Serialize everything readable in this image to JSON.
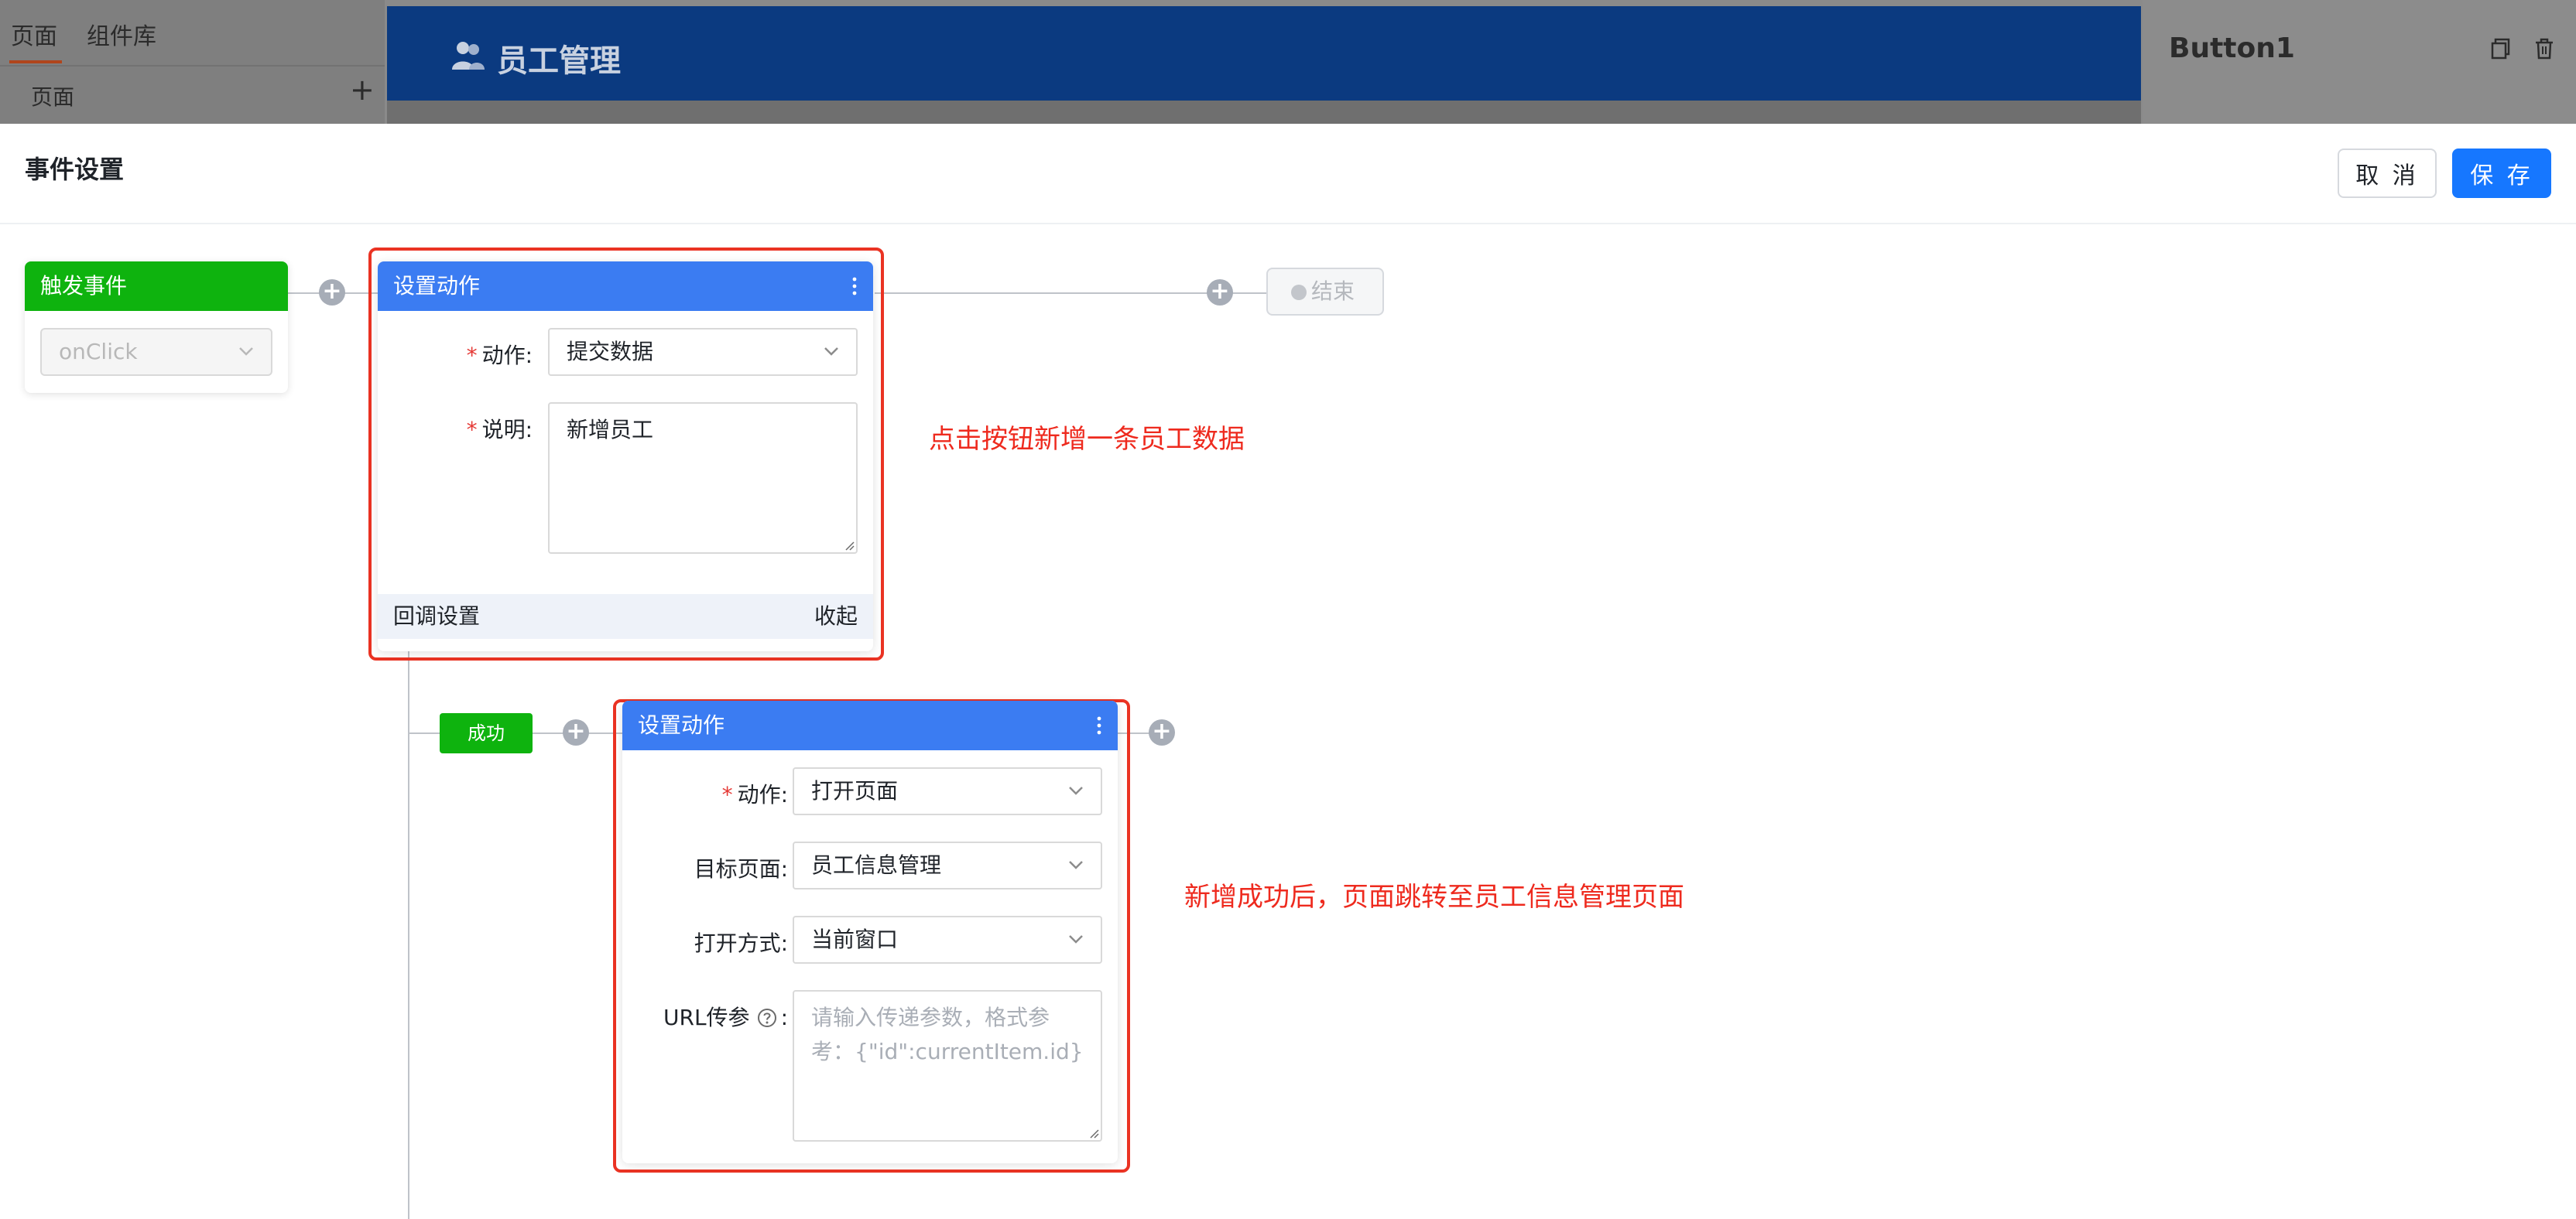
{
  "background": {
    "left_tabs": [
      "页面",
      "组件库"
    ],
    "left_section_label": "页面",
    "add_symbol": "+",
    "app_title": "员工管理",
    "right_component_name": "Button1"
  },
  "modal": {
    "title": "事件设置",
    "cancel_label": "取 消",
    "save_label": "保 存"
  },
  "trigger": {
    "title": "触发事件",
    "event_value": "onClick"
  },
  "action1": {
    "title": "设置动作",
    "action_label": "动作:",
    "action_value": "提交数据",
    "desc_label": "说明:",
    "desc_value": "新增员工",
    "callback_label": "回调设置",
    "collapse_label": "收起"
  },
  "end_node": {
    "label": "结束"
  },
  "success_badge": "成功",
  "action2": {
    "title": "设置动作",
    "action_label": "动作:",
    "action_value": "打开页面",
    "target_label": "目标页面:",
    "target_value": "员工信息管理",
    "open_label": "打开方式:",
    "open_value": "当前窗口",
    "url_label": "URL传参",
    "url_colon": ":",
    "url_placeholder": "请输入传递参数，格式参考：{\"id\":currentItem.id}"
  },
  "annotations": {
    "note1": "点击按钮新增一条员工数据",
    "note2": "新增成功后，页面跳转至员工信息管理页面"
  },
  "plus_symbol": "+",
  "colors": {
    "primary": "#1677ff",
    "action_header": "#3b7cf2",
    "trigger_header": "#0eb30e",
    "annotation_red": "#ea3323"
  }
}
